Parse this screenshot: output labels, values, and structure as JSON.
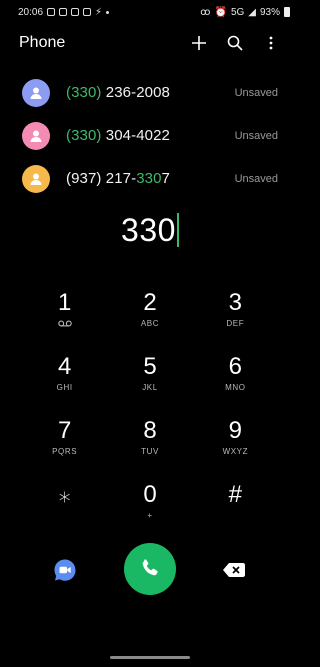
{
  "status_bar": {
    "time": "20:06",
    "network": "5G",
    "battery": "93%"
  },
  "app_bar": {
    "title": "Phone",
    "actions": [
      "add-icon",
      "search-icon",
      "more-options-icon"
    ]
  },
  "contacts": [
    {
      "number_match": "(330)",
      "number_rest": " 236-2008",
      "number_pre": "",
      "status": "Unsaved",
      "avatar_color": "#8c9cf2"
    },
    {
      "number_match": "(330)",
      "number_rest": " 304-4022",
      "number_pre": "",
      "status": "Unsaved",
      "avatar_color": "#f48bb5"
    },
    {
      "number_pre": "(937) 217-",
      "number_match": "330",
      "number_rest": "7",
      "status": "Unsaved",
      "avatar_color": "#f6b94c"
    }
  ],
  "dial_input": {
    "value": "330"
  },
  "keypad": [
    {
      "digit": "1",
      "sub": ""
    },
    {
      "digit": "2",
      "sub": "ABC"
    },
    {
      "digit": "3",
      "sub": "DEF"
    },
    {
      "digit": "4",
      "sub": "GHI"
    },
    {
      "digit": "5",
      "sub": "JKL"
    },
    {
      "digit": "6",
      "sub": "MNO"
    },
    {
      "digit": "7",
      "sub": "PQRS"
    },
    {
      "digit": "8",
      "sub": "TUV"
    },
    {
      "digit": "9",
      "sub": "WXYZ"
    },
    {
      "digit": "⁎",
      "sub": ""
    },
    {
      "digit": "0",
      "sub": "+"
    },
    {
      "digit": "#",
      "sub": ""
    }
  ],
  "colors": {
    "accent": "#3fb86b",
    "call_button": "#1ab765",
    "video_call": "#5b8cf0"
  }
}
